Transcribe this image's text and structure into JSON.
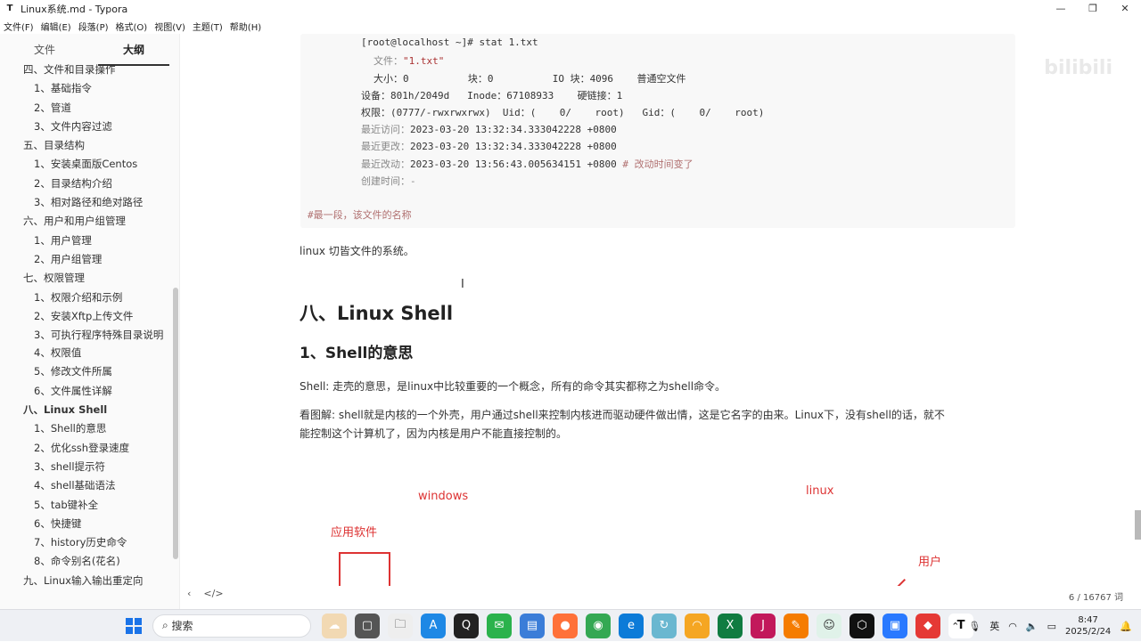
{
  "window": {
    "title": "Linux系统.md - Typora",
    "app_icon": "T",
    "minimize": "—",
    "maximize": "❐",
    "close": "✕"
  },
  "menu": [
    "文件(F)",
    "编辑(E)",
    "段落(P)",
    "格式(O)",
    "视图(V)",
    "主题(T)",
    "帮助(H)"
  ],
  "sidebar": {
    "tabs": [
      "文件",
      "大纲"
    ],
    "outline": [
      {
        "text": "四、文件和目录操作",
        "level": 1
      },
      {
        "text": "1、基础指令",
        "level": 2
      },
      {
        "text": "2、管道",
        "level": 2
      },
      {
        "text": "3、文件内容过滤",
        "level": 2
      },
      {
        "text": "五、目录结构",
        "level": 1
      },
      {
        "text": "1、安装桌面版Centos",
        "level": 2
      },
      {
        "text": "2、目录结构介绍",
        "level": 2
      },
      {
        "text": "3、相对路径和绝对路径",
        "level": 2
      },
      {
        "text": "六、用户和用户组管理",
        "level": 1
      },
      {
        "text": "1、用户管理",
        "level": 2
      },
      {
        "text": "2、用户组管理",
        "level": 2
      },
      {
        "text": "七、权限管理",
        "level": 1
      },
      {
        "text": "1、权限介绍和示例",
        "level": 2
      },
      {
        "text": "2、安装Xftp上传文件",
        "level": 2
      },
      {
        "text": "3、可执行程序特殊目录说明",
        "level": 2,
        "wrap": true
      },
      {
        "text": "4、权限值",
        "level": 2
      },
      {
        "text": "5、修改文件所属",
        "level": 2
      },
      {
        "text": "6、文件属性详解",
        "level": 2
      },
      {
        "text": "八、Linux Shell",
        "level": 1,
        "bold": true
      },
      {
        "text": "1、Shell的意思",
        "level": 2
      },
      {
        "text": "2、优化ssh登录速度",
        "level": 2
      },
      {
        "text": "3、shell提示符",
        "level": 2
      },
      {
        "text": "4、shell基础语法",
        "level": 2
      },
      {
        "text": "5、tab键补全",
        "level": 2
      },
      {
        "text": "6、快捷键",
        "level": 2
      },
      {
        "text": "7、history历史命令",
        "level": 2
      },
      {
        "text": "8、命令别名(花名)",
        "level": 2
      },
      {
        "text": "九、Linux输入输出重定向",
        "level": 1
      }
    ]
  },
  "footer": {
    "back": "‹",
    "source": "</>",
    "word_count": "6 / 16767 词"
  },
  "code": {
    "prompt": "[root@localhost ~]# stat 1.txt",
    "l1_label": "文件：",
    "l1_value": "\"1.txt\"",
    "l2": "大小：0          块：0          IO 块：4096    普通空文件",
    "l3": "设备：801h/2049d   Inode：67108933    硬链接：1",
    "l4": "权限：(0777/-rwxrwxrwx)  Uid：(    0/    root)   Gid：(    0/    root)",
    "l5_label": "最近访问：",
    "l5_value": "2023-03-20 13:32:34.333042228 +0800",
    "l6_label": "最近更改：",
    "l6_value": "2023-03-20 13:32:34.333042228 +0800",
    "l7_label": "最近改动：",
    "l7_value": "2023-03-20 13:56:43.005634151 +0800",
    "l7_comment": " # 改动时间变了",
    "l8": "创建时间：-",
    "comment": "#最一段，该文件的名称"
  },
  "content": {
    "p1": "linux   切皆文件的系统。",
    "h1": "八、Linux Shell",
    "h2": "1、Shell的意思",
    "p2": "Shell: 走壳的意思，是linux中比较重要的一个概念，所有的命令其实都称之为shell命令。",
    "p3a": "看图解: shell就是内核的一个外壳，用户通过shell来控制内核进而驱动硬件做出情，这是它名字的由来。Linux下，没有shell的话，就不",
    "p3b": "能控制这个计算机了，因为内核是用户不能直接控制的。"
  },
  "diagram": {
    "windows": "windows",
    "linux": "linux",
    "app": "应用软件",
    "user": "用户"
  },
  "watermark": "bilibili",
  "taskbar": {
    "search": "搜索",
    "lang": "英",
    "time": "8:47",
    "date": "2025/2/24"
  },
  "colors": {
    "accent_red": "#dd3333",
    "taskbar_bg": "#eef0f4"
  }
}
